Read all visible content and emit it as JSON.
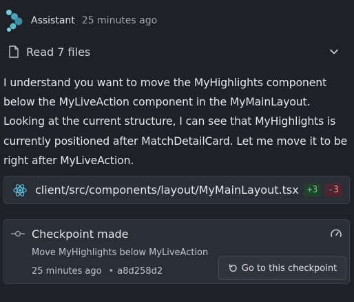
{
  "header": {
    "author": "Assistant",
    "time": "25 minutes ago",
    "logo_icon": "assistant-logo-icon"
  },
  "read_files": {
    "label": "Read 7 files",
    "icon": "file-icon",
    "toggle_icon": "chevron-down-icon"
  },
  "message": {
    "text": "I understand you want to move the MyHighlights component below the MyLiveAction component in the MyMainLayout. Looking at the current structure, I can see that MyHighlights is currently positioned after MatchDetailCard. Let me move it to be right after MyLiveAction."
  },
  "file_card": {
    "path": "client/src/components/layout/MyMainLayout.tsx",
    "additions": "+3",
    "deletions": "-3",
    "icon": "react-icon"
  },
  "checkpoint": {
    "title": "Checkpoint made",
    "description": "Move MyHighlights below MyLiveAction",
    "time": "25 minutes ago",
    "separator": "•",
    "hash": "a8d258d2",
    "button_label": "Go to this checkpoint",
    "icons": [
      "commit-icon",
      "gauge-icon",
      "undo-icon"
    ]
  },
  "colors": {
    "background": "#1e2127",
    "card": "#2a2e36",
    "logo": "#5bb8c9",
    "additions": "#4fcf70",
    "deletions": "#ff8a8a"
  }
}
